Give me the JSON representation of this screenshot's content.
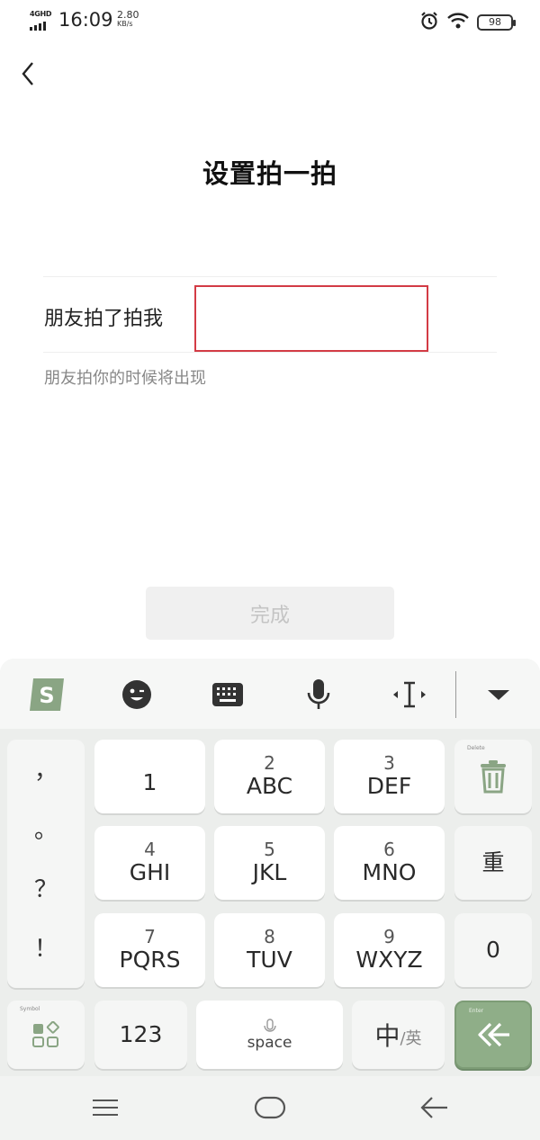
{
  "status_bar": {
    "network": "4GHD",
    "time": "16:09",
    "speed_value": "2.80",
    "speed_unit": "KB/s",
    "battery": "98"
  },
  "header": {
    "title": "设置拍一拍"
  },
  "form": {
    "label": "朋友拍了拍我",
    "input_value": "",
    "hint": "朋友拍你的时候将出现"
  },
  "done_button": "完成",
  "keyboard": {
    "toolbar_icons": [
      "sogou-logo-icon",
      "emoji-icon",
      "keyboard-icon",
      "microphone-icon",
      "cursor-icon",
      "collapse-icon"
    ],
    "punctuation": [
      "，",
      "。",
      "？",
      "！"
    ],
    "keys": {
      "k1": {
        "num": "",
        "letters": "1"
      },
      "k2": {
        "num": "2",
        "letters": "ABC"
      },
      "k3": {
        "num": "3",
        "letters": "DEF"
      },
      "k4": {
        "num": "4",
        "letters": "GHI"
      },
      "k5": {
        "num": "5",
        "letters": "JKL"
      },
      "k6": {
        "num": "6",
        "letters": "MNO"
      },
      "k7": {
        "num": "7",
        "letters": "PQRS"
      },
      "k8": {
        "num": "8",
        "letters": "TUV"
      },
      "k9": {
        "num": "9",
        "letters": "WXYZ"
      }
    },
    "delete_tiny": "Delete",
    "reset_label": "重",
    "zero_label": "0",
    "symbol_tiny": "Symbol",
    "num_switch": "123",
    "space_label": "space",
    "lang_main": "中",
    "lang_sub": "/英",
    "enter_tiny": "Enter",
    "accent_color": "#8fae88"
  },
  "navbar": {
    "icons": [
      "menu-icon",
      "home-icon",
      "back-arrow-icon"
    ]
  },
  "colors": {
    "input_border": "#d33b45",
    "disabled_text": "#c4c4c4"
  }
}
